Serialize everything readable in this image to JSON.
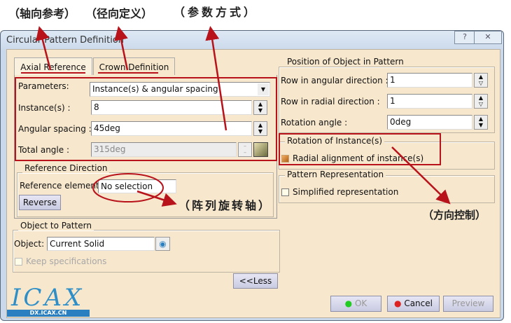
{
  "annotations": {
    "axial": "（轴向参考）",
    "radial": "（径向定义）",
    "params": "（参数方式）",
    "axis": "（阵列旋转轴）",
    "direction": "（方向控制）"
  },
  "window": {
    "title": "Circular Pattern Definition",
    "help": "?",
    "close": "✕"
  },
  "tabs": [
    {
      "label": "Axial Reference"
    },
    {
      "label": "Crown Definition"
    }
  ],
  "parameters": {
    "label": "Parameters:",
    "value": "Instance(s) & angular spacing"
  },
  "instances": {
    "label": "Instance(s) :",
    "value": "8"
  },
  "angular_spacing": {
    "label": "Angular spacing :",
    "value": "45deg"
  },
  "total_angle": {
    "label": "Total angle :",
    "value": "315deg"
  },
  "reference_direction": {
    "title": "Reference Direction",
    "label": "Reference element:",
    "value": "No selection",
    "reverse": "Reverse"
  },
  "object_to_pattern": {
    "title": "Object to Pattern",
    "label": "Object:",
    "value": "Current Solid",
    "keep": "Keep specifications"
  },
  "less": "<<Less",
  "position": {
    "title": "Position of Object in Pattern",
    "angular_label": "Row in angular direction :",
    "angular_value": "1",
    "radial_label": "Row in radial direction :",
    "radial_value": "1",
    "rotation_label": "Rotation angle :",
    "rotation_value": "0deg"
  },
  "rotation_of_instances": {
    "title": "Rotation of Instance(s)",
    "radial_alignment": "Radial alignment of instance(s)"
  },
  "pattern_representation": {
    "title": "Pattern Representation",
    "simplified": "Simplified representation"
  },
  "buttons": {
    "ok": "OK",
    "cancel": "Cancel",
    "preview": "Preview"
  },
  "logo": {
    "text": "ICAX",
    "url": "DX.ICAX.CN"
  },
  "colors": {
    "annotation": "#b8121b",
    "panel": "#f7e7cd"
  }
}
